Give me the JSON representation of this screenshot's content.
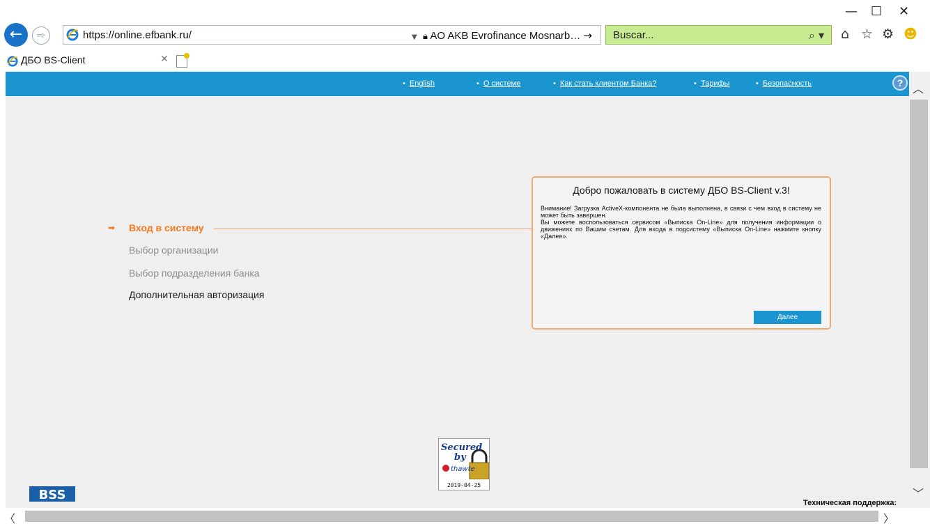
{
  "browser": {
    "window_controls": {
      "minimize": "—",
      "maximize": "☐",
      "close": "✕"
    },
    "address_bar": {
      "url": "https://online.efbank.ru/",
      "site_identity": "AO AKB Evrofinance Mosnarb…"
    },
    "search": {
      "placeholder": "Buscar..."
    },
    "tab": {
      "title": "ДБО BS-Client"
    },
    "icons": [
      "back-icon",
      "forward-icon",
      "ie-icon",
      "lock-icon",
      "search-icon",
      "home-icon",
      "star-icon",
      "gear-icon",
      "smiley-icon"
    ]
  },
  "page": {
    "nav": [
      "English",
      "О системе",
      "Как стать клиентом Банка?",
      "Тарифы",
      "Безопасность"
    ],
    "help_icon": "?",
    "steps": [
      {
        "label": "Вход в систему",
        "state": "active"
      },
      {
        "label": "Выбор организации",
        "state": "disabled"
      },
      {
        "label": "Выбор подразделения банка",
        "state": "disabled"
      },
      {
        "label": "Дополнительная авторизация",
        "state": "normal"
      }
    ],
    "dialog": {
      "title": "Добро пожаловать в систему ДБО BS-Client v.3!",
      "text_1": "Внимание! Загрузка ActiveX-компонента не была выполнена, в связи с чем вход в систему не может быть завершен.",
      "text_2": "Вы можете воспользоваться сервисом «Выписка On-Line» для получения информации о движениях по Вашим счетам. Для входа в подсистему «Выписка On-Line» нажмите кнопку «Далее».",
      "next_label": "Далее"
    },
    "seal": {
      "line1": "Secured",
      "line2": "by",
      "brand": "thawte",
      "date": "2019-04-25"
    },
    "logo_text": "BSS",
    "support_label": "Техническая поддержка:"
  },
  "colors": {
    "nav_bar": "#1b95cf",
    "accent_orange": "#f47a20",
    "search_bg": "#c8ea90"
  }
}
